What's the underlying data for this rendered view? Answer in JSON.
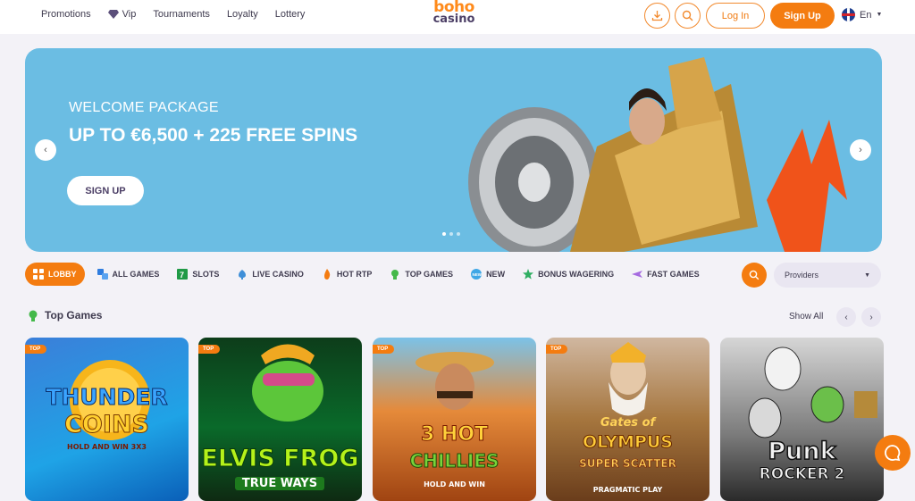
{
  "header": {
    "nav": [
      "Promotions",
      "Vip",
      "Tournaments",
      "Loyalty",
      "Lottery"
    ],
    "logo_top": "boho",
    "logo_bottom": "casino",
    "login_label": "Log In",
    "signup_label": "Sign Up",
    "language": "En"
  },
  "banner": {
    "subtitle": "WELCOME PACKAGE",
    "title": "UP TO €6,500 + 225 FREE SPINS",
    "button_label": "SIGN UP",
    "active_slide": 1,
    "slides": 3
  },
  "categories": [
    {
      "label": "LOBBY",
      "icon": "grid-icon",
      "active": true
    },
    {
      "label": "ALL GAMES",
      "icon": "all-games-icon"
    },
    {
      "label": "SLOTS",
      "icon": "slots-icon"
    },
    {
      "label": "LIVE CASINO",
      "icon": "diamond-icon"
    },
    {
      "label": "HOT RTP",
      "icon": "flame-icon"
    },
    {
      "label": "TOP GAMES",
      "icon": "trophy-icon"
    },
    {
      "label": "NEW",
      "icon": "new-icon"
    },
    {
      "label": "BONUS WAGERING",
      "icon": "star-icon"
    },
    {
      "label": "FAST GAMES",
      "icon": "plane-icon"
    }
  ],
  "providers_label": "Providers",
  "section": {
    "title": "Top Games",
    "show_all": "Show All"
  },
  "games": [
    {
      "badge": "TOP",
      "title1": "THUNDER",
      "title2": "COINS",
      "title3": "HOLD AND WIN 3X3"
    },
    {
      "badge": "TOP",
      "title1": "ELVIS FROG",
      "title2": "TRUE WAYS"
    },
    {
      "badge": "TOP",
      "title1": "3 HOT",
      "title2": "CHILLIES",
      "title3": "HOLD AND WIN"
    },
    {
      "badge": "TOP",
      "title1": "Gates of",
      "title2": "OLYMPUS",
      "title3": "SUPER SCATTER",
      "title4": "PRAGMATIC PLAY"
    },
    {
      "title1": "Punk",
      "title2": "ROCKER 2"
    }
  ],
  "colors": {
    "accent": "#f47c10",
    "banner": "#6bbde3",
    "background": "#f3f2f7"
  }
}
